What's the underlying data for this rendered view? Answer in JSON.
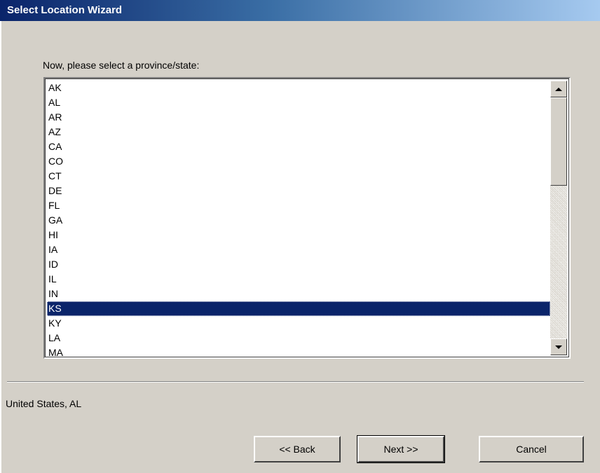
{
  "window": {
    "title": "Select Location Wizard"
  },
  "prompt": {
    "label": "Now, please select a province/state:"
  },
  "states_list": {
    "items": [
      "AK",
      "AL",
      "AR",
      "AZ",
      "CA",
      "CO",
      "CT",
      "DE",
      "FL",
      "GA",
      "HI",
      "IA",
      "ID",
      "IL",
      "IN",
      "KS",
      "KY",
      "LA",
      "MA"
    ],
    "selected": "KS"
  },
  "status": {
    "text": "United States, AL"
  },
  "buttons": {
    "back_label": "<< Back",
    "next_label": "Next >>",
    "cancel_label": "Cancel"
  },
  "colors": {
    "title_bar": "#0a246a",
    "selection": "#0a246a",
    "dialog_background": "#d4d0c8"
  }
}
